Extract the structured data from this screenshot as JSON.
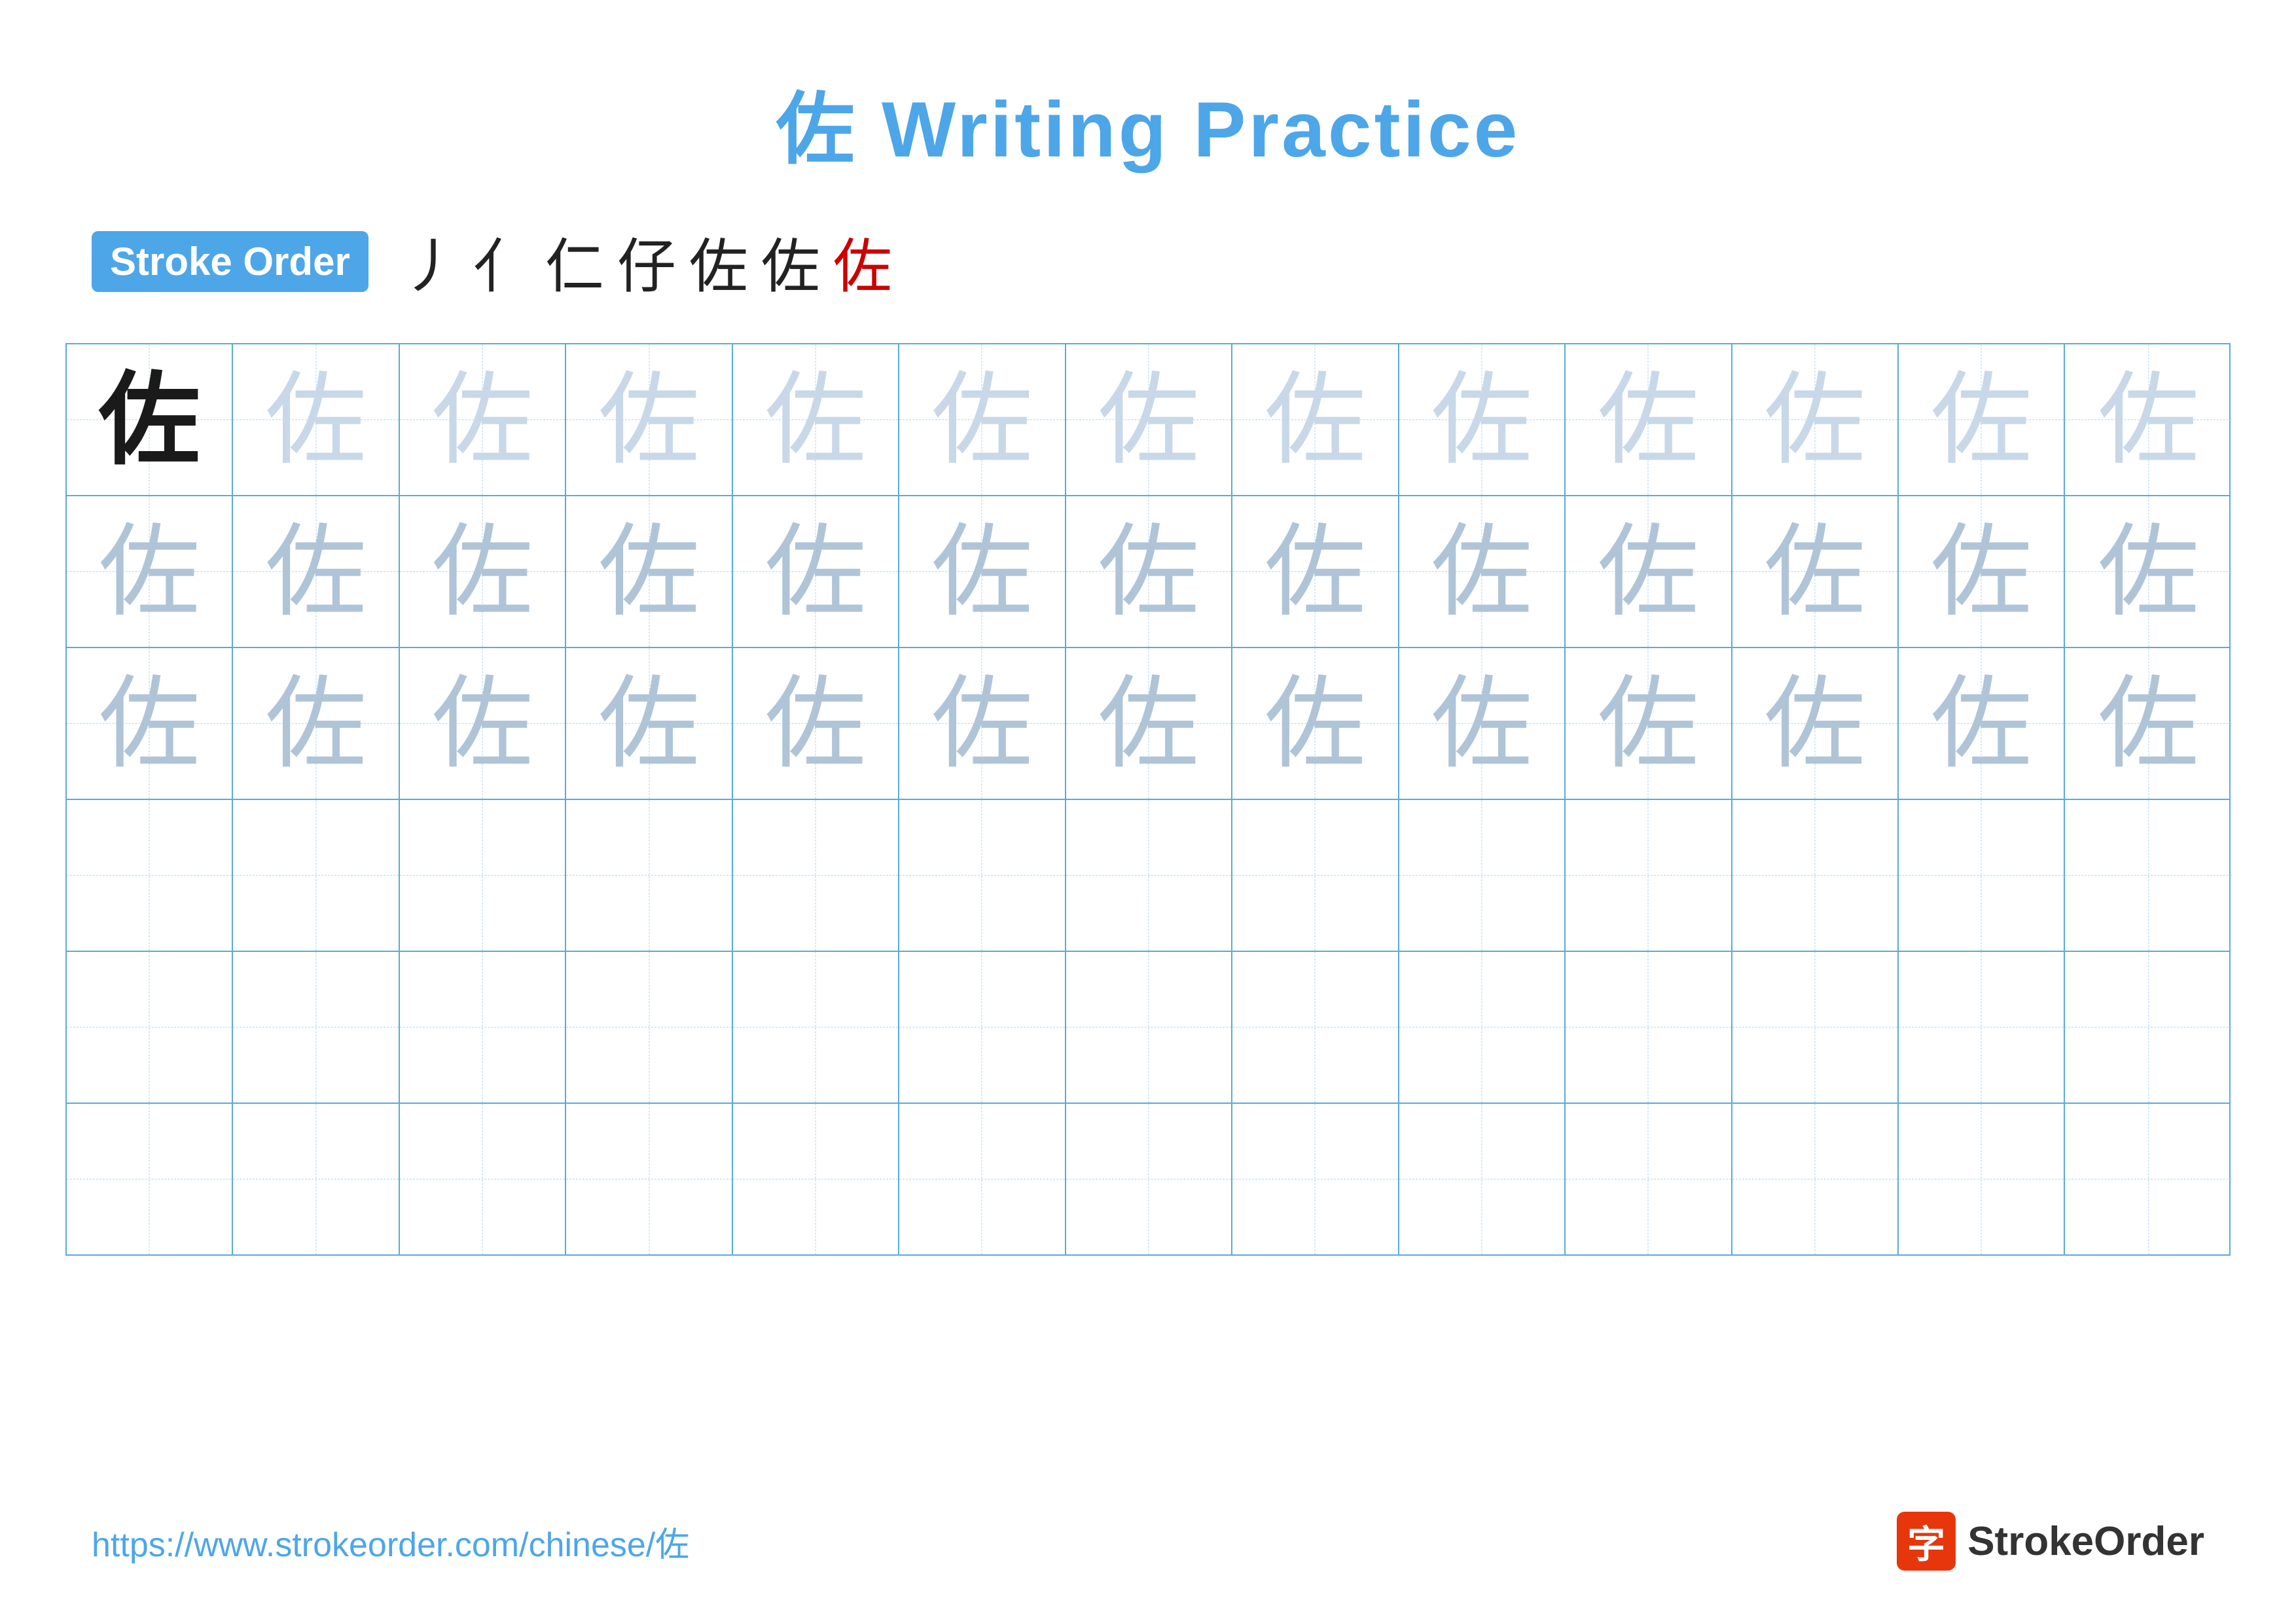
{
  "title": "佐 Writing Practice",
  "stroke_order": {
    "badge_label": "Stroke Order",
    "strokes": [
      "丿",
      "亻",
      "仁",
      "仔",
      "佐",
      "佐",
      "佐"
    ]
  },
  "grid": {
    "character": "佐",
    "rows": 6,
    "cols": 13,
    "row_types": [
      "dark_first_light_rest",
      "light_all",
      "light_all",
      "empty",
      "empty",
      "empty"
    ]
  },
  "footer": {
    "url": "https://www.strokeorder.com/chinese/佐",
    "logo_text": "StrokeOrder",
    "logo_char": "字"
  }
}
